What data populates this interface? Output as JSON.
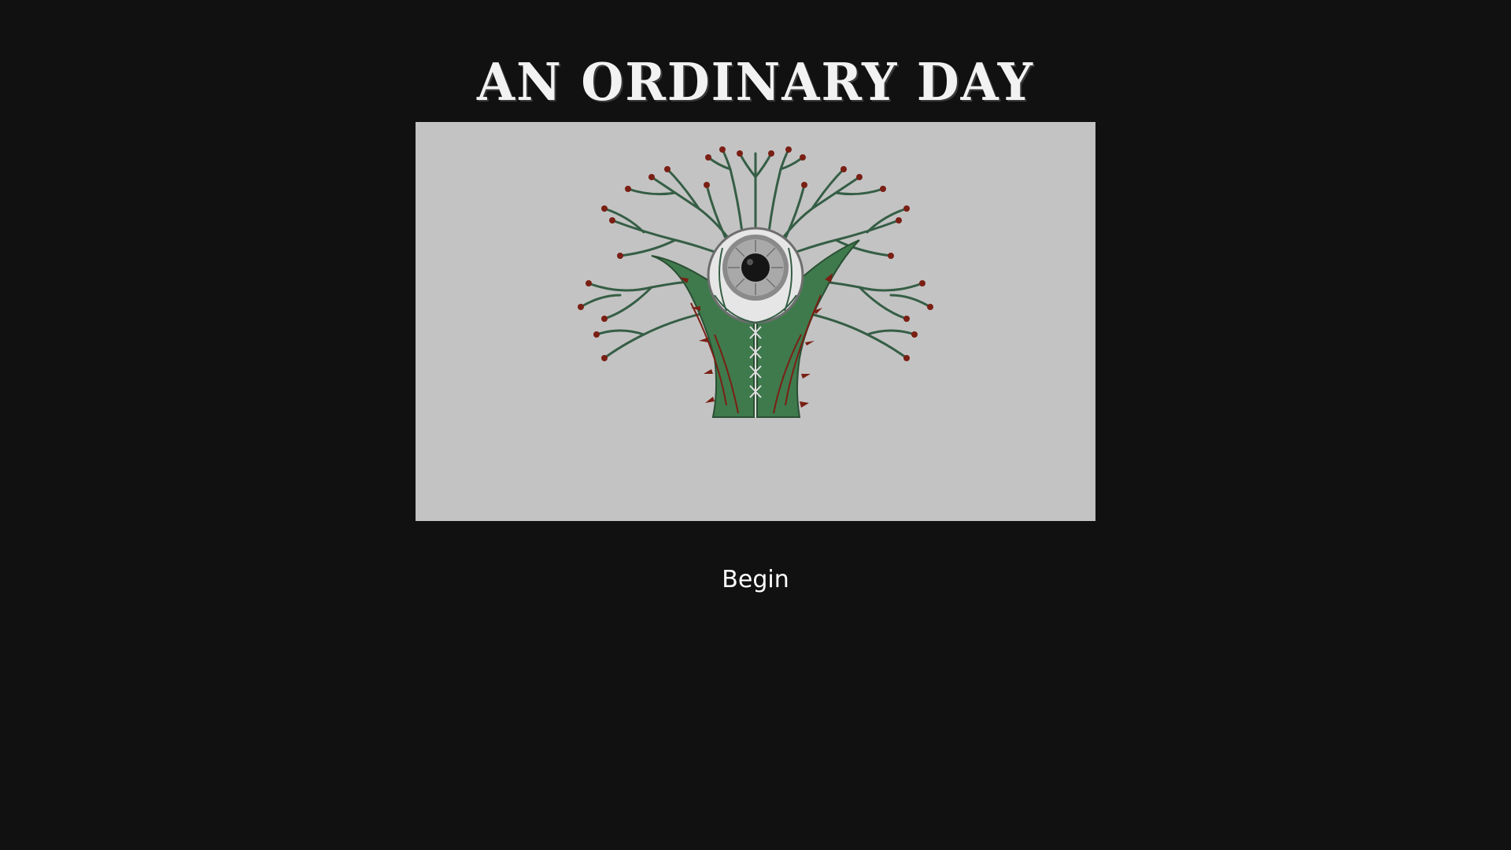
{
  "title": "AN ORDINARY DAY",
  "begin_label": "Begin",
  "artwork": {
    "icon": "eye-held-by-thorny-hands-emblem",
    "colors": {
      "background": "#c3c3c3",
      "hands": "#3f7a4d",
      "branches": "#355e45",
      "thorns": "#7a1f14",
      "eye_white": "#e6e6e6",
      "iris": "#8a8a8a",
      "pupil": "#151515"
    }
  },
  "colors": {
    "page_background": "#111111",
    "title_text": "#f2f2f2",
    "button_text": "#ffffff"
  }
}
